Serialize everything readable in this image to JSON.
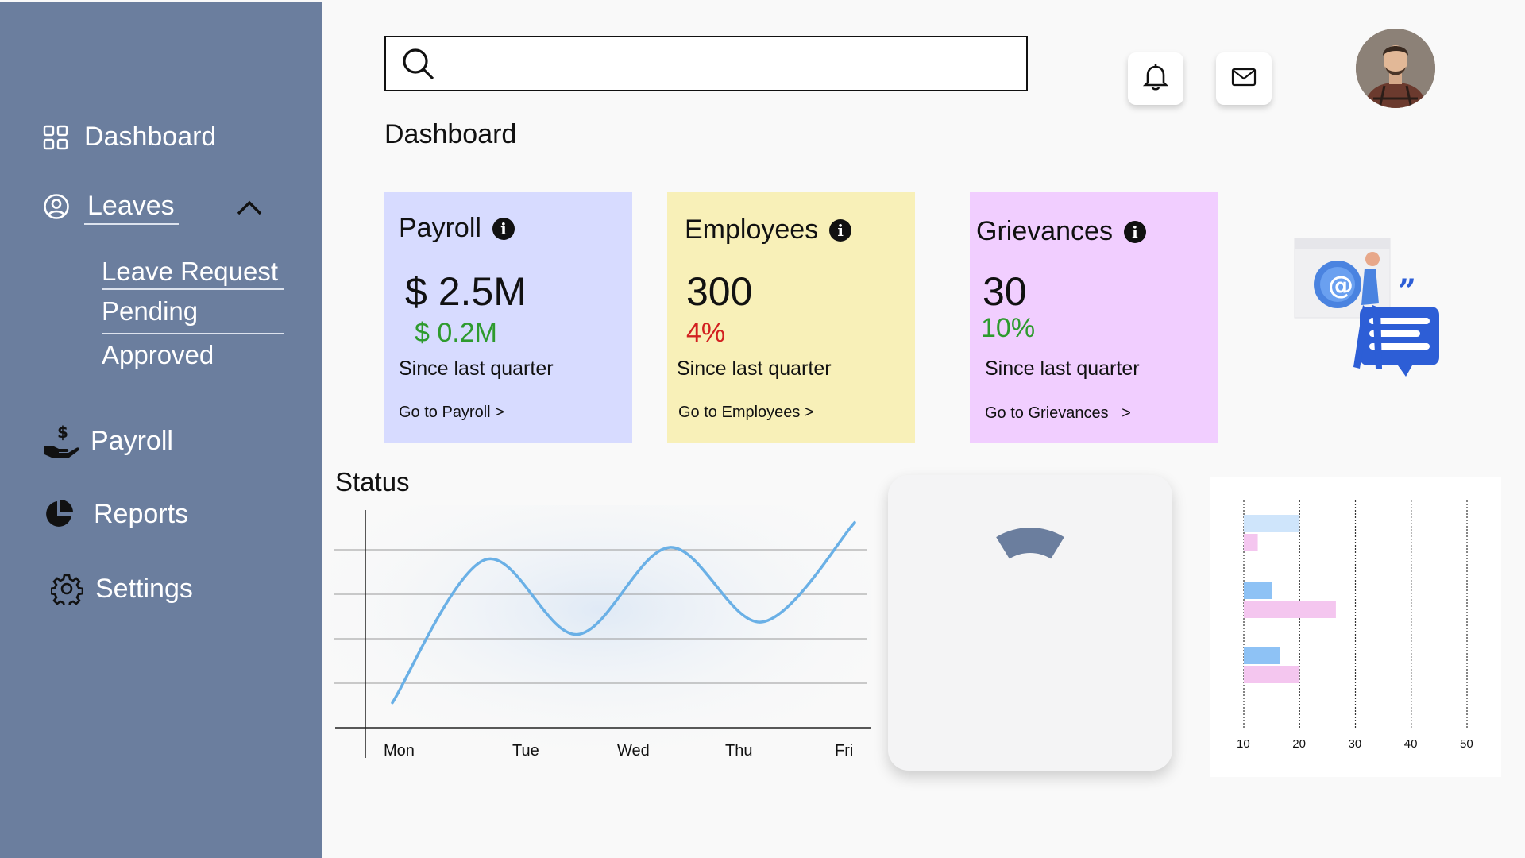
{
  "sidebar": {
    "items": [
      {
        "label": "Dashboard",
        "icon": "grid-icon"
      },
      {
        "label": "Leaves",
        "icon": "user-circle-icon",
        "expanded": true
      },
      {
        "label": "Payroll",
        "icon": "hand-dollar-icon"
      },
      {
        "label": "Reports",
        "icon": "pie-chart-icon"
      },
      {
        "label": "Settings",
        "icon": "gear-icon"
      }
    ],
    "leave_subitems": [
      "Leave Request",
      "Pending",
      "Approved"
    ]
  },
  "header": {
    "search_placeholder": "",
    "icons": [
      "bell-icon",
      "mail-icon"
    ]
  },
  "page_title": "Dashboard",
  "cards": [
    {
      "title": "Payroll",
      "value": "$ 2.5M",
      "delta": "$ 0.2M",
      "delta_color": "#2e9b2e",
      "since": "Since last quarter",
      "link": "Go to Payroll >",
      "bg": "#d7dbff"
    },
    {
      "title": "Employees",
      "value": "300",
      "delta": "4%",
      "delta_color": "#d22020",
      "since": "Since last quarter",
      "link": "Go to Employees >",
      "bg": "#f8f0b8"
    },
    {
      "title": "Grievances",
      "value": "30",
      "delta": "10%",
      "delta_color": "#2e9b2e",
      "since": "Since last quarter",
      "link": "Go to Grievances   >",
      "bg": "#f1ceff"
    }
  ],
  "colors": {
    "sidebar": "#6b7e9e",
    "line": "#6ab0e6",
    "gauge": "#6b7e9e",
    "bar_blue": "#8ec2f5",
    "bar_pink": "#f4c6ef"
  },
  "chart_data": [
    {
      "type": "line",
      "title": "Status",
      "categories": [
        "Mon",
        "Tue",
        "Wed",
        "Thu",
        "Fri"
      ],
      "series": [
        {
          "values": [
            0.8,
            5.4,
            3.0,
            5.8,
            3.4,
            6.6
          ]
        }
      ],
      "grid": true
    },
    {
      "type": "gauge",
      "value_fraction": 0.35
    },
    {
      "type": "bar",
      "orientation": "horizontal",
      "xlim": [
        10,
        50
      ],
      "xticks": [
        10,
        20,
        30,
        40,
        50
      ],
      "groups": [
        {
          "blue": 20,
          "pink": 12.5
        },
        {
          "blue": 15,
          "pink": 26.5
        },
        {
          "blue": 16.5,
          "pink": 20
        }
      ],
      "grid": true
    }
  ]
}
